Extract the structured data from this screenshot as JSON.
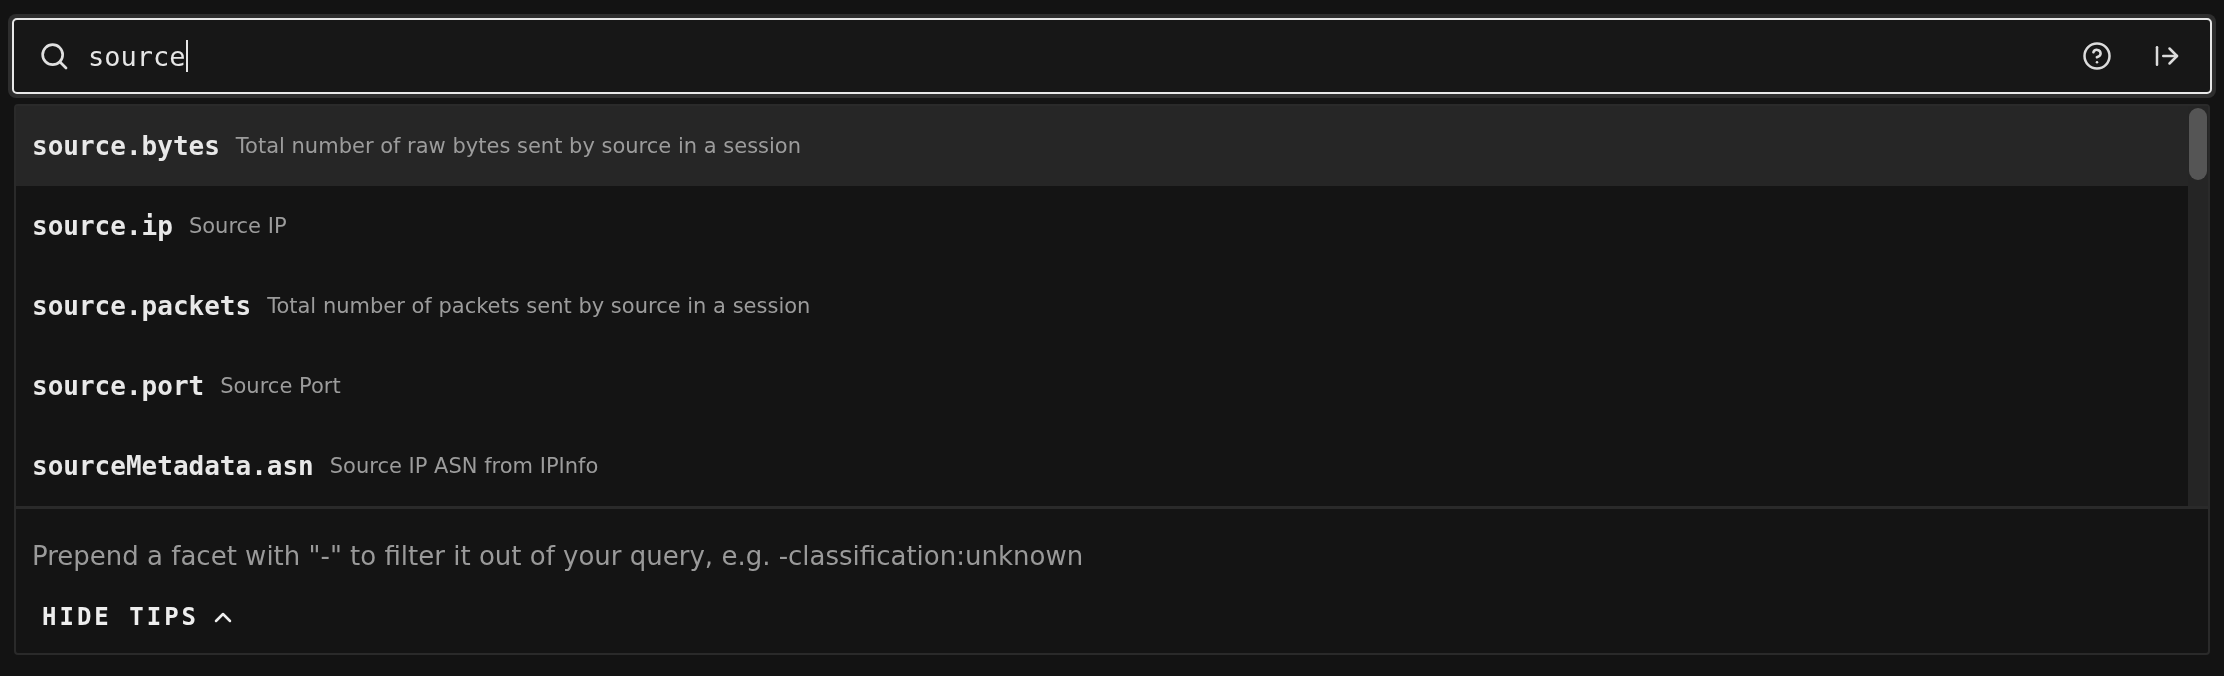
{
  "search": {
    "value": "source"
  },
  "suggestions": [
    {
      "field": "source.bytes",
      "description": "Total number of raw bytes sent by source in a session",
      "selected": true
    },
    {
      "field": "source.ip",
      "description": "Source IP",
      "selected": false
    },
    {
      "field": "source.packets",
      "description": "Total number of packets sent by source in a session",
      "selected": false
    },
    {
      "field": "source.port",
      "description": "Source Port",
      "selected": false
    },
    {
      "field": "sourceMetadata.asn",
      "description": "Source IP ASN from IPInfo",
      "selected": false
    }
  ],
  "tip": "Prepend a facet with \"-\" to filter it out of your query, e.g. -classification:unknown",
  "hide_tips_button": "HIDE TIPS"
}
